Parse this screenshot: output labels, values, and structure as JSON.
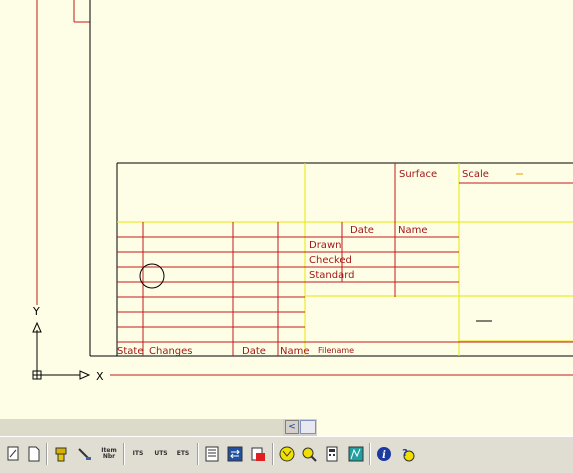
{
  "title_block": {
    "surface": "Surface",
    "scale": "Scale",
    "scale_value": "—",
    "date_header": "Date",
    "name_header": "Name",
    "drawn": "Drawn",
    "checked": "Checked",
    "standard": "Standard",
    "state": "State",
    "changes": "Changes",
    "date": "Date",
    "name": "Name",
    "filename": "Filename",
    "dash": "—"
  },
  "ucs": {
    "x_label": "X",
    "y_label": "Y"
  },
  "scrollbar": {
    "left_arrow": "<"
  },
  "toolbar": {
    "items": [
      {
        "icon": "edit-icon",
        "label": ""
      },
      {
        "icon": "new-sheet-icon",
        "label": ""
      },
      {
        "icon": "block-icon",
        "label": ""
      },
      {
        "icon": "wrench-icon",
        "label": ""
      },
      {
        "icon": "item-number-icon",
        "label": "Item Nbr"
      },
      {
        "icon": "its-icon",
        "label": "ITS"
      },
      {
        "icon": "uts-icon",
        "label": "UTS"
      },
      {
        "icon": "ets-icon",
        "label": "ETS"
      },
      {
        "icon": "list-icon",
        "label": ""
      },
      {
        "icon": "swap-icon",
        "label": ""
      },
      {
        "icon": "flag-icon",
        "label": ""
      },
      {
        "icon": "filter-icon",
        "label": ""
      },
      {
        "icon": "magnify-icon",
        "label": ""
      },
      {
        "icon": "calculator-icon",
        "label": ""
      },
      {
        "icon": "chart-icon",
        "label": ""
      },
      {
        "icon": "info-icon",
        "label": ""
      },
      {
        "icon": "help-icon",
        "label": ""
      }
    ]
  },
  "colors": {
    "background": "#fefee6",
    "red_line": "#c41a1a",
    "yellow_line": "#e8e800",
    "black_line": "#000000",
    "text": "#a31818"
  }
}
